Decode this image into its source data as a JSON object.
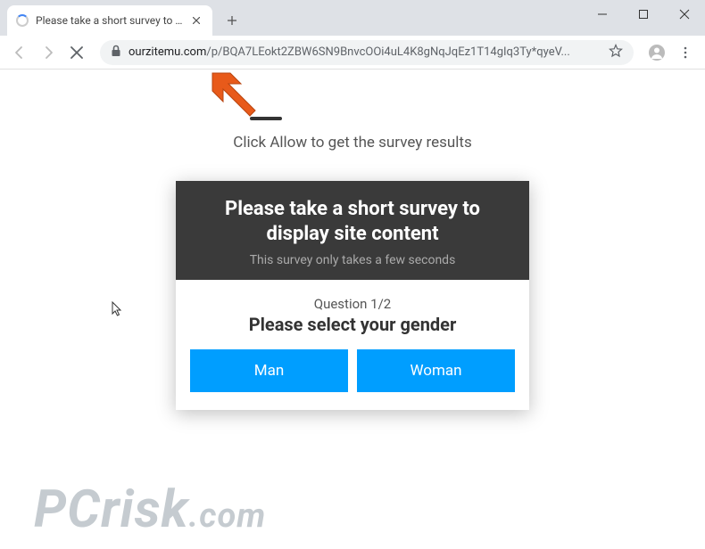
{
  "window": {
    "tab_title": "Please take a short survey to disp"
  },
  "address": {
    "domain": "ourzitemu.com",
    "path": "/p/BQA7LEokt2ZBW6SN9BnvcOOi4uL4K8gNqJqEz1T14gIq3Ty*qyeV..."
  },
  "page": {
    "allow_text": "Click Allow to get the survey results"
  },
  "survey": {
    "title_line1": "Please take a short survey to",
    "title_line2": "display site content",
    "subtitle": "This survey only takes a few seconds",
    "question_num": "Question 1/2",
    "question_text": "Please select your gender",
    "answers": {
      "man": "Man",
      "woman": "Woman"
    }
  },
  "watermark": {
    "brand": "PCrisk",
    "tld": ".com"
  }
}
